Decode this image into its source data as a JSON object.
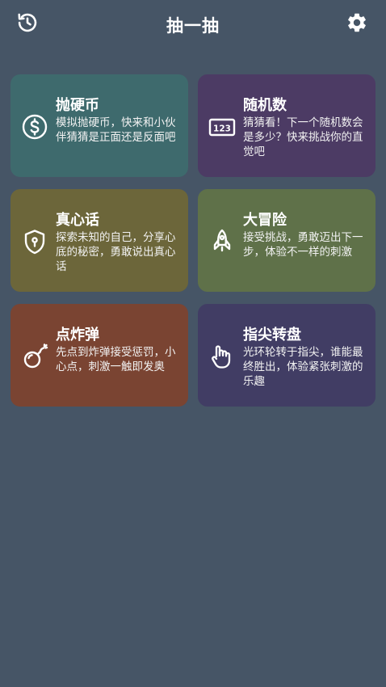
{
  "header": {
    "title": "抽一抽",
    "history_icon": "history-icon",
    "settings_icon": "gear-icon"
  },
  "cards": [
    {
      "title": "抛硬币",
      "description": "模拟抛硬币，快来和小伙伴猜猜是正面还是反面吧",
      "icon": "dollar-coin-icon",
      "color": "#3E6A6D"
    },
    {
      "title": "随机数",
      "description": "猜猜看！下一个随机数会是多少？快来挑战你的直觉吧",
      "icon": "number-123-icon",
      "icon_text": "123",
      "color": "#4C3B64"
    },
    {
      "title": "真心话",
      "description": "探索未知的自己，分享心底的秘密，勇敢说出真心话",
      "icon": "shield-lock-icon",
      "color": "#6C663A"
    },
    {
      "title": "大冒险",
      "description": "接受挑战，勇敢迈出下一步，体验不一样的刺激",
      "icon": "rocket-icon",
      "color": "#5F7149"
    },
    {
      "title": "点炸弹",
      "description": "先点到炸弹接受惩罚，小心点，刺激一触即发奥",
      "icon": "bomb-icon",
      "color": "#7A4432"
    },
    {
      "title": "指尖转盘",
      "description": "光环轮转于指尖，谁能最终胜出，体验紧张刺激的乐趣",
      "icon": "hand-pointer-icon",
      "color": "#413D64"
    }
  ]
}
